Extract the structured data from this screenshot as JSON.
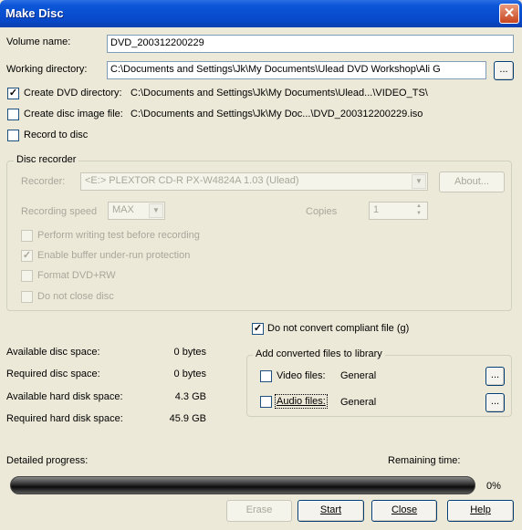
{
  "window": {
    "title": "Make Disc"
  },
  "volume": {
    "label": "Volume name:",
    "value": "DVD_200312200229"
  },
  "working_dir": {
    "label": "Working directory:",
    "value": "C:\\Documents and Settings\\Jk\\My Documents\\Ulead DVD Workshop\\Ali G",
    "browse_label": "..."
  },
  "create_dvd_dir": {
    "label": "Create DVD directory:",
    "checked": true,
    "path": "C:\\Documents and Settings\\Jk\\My Documents\\Ulead...\\VIDEO_TS\\"
  },
  "create_image": {
    "label": "Create disc image file:",
    "checked": false,
    "path": "C:\\Documents and Settings\\Jk\\My Doc...\\DVD_200312200229.iso"
  },
  "record_to_disc": {
    "label": "Record to disc",
    "checked": false
  },
  "disc_recorder": {
    "legend": "Disc recorder",
    "recorder_label": "Recorder:",
    "recorder_value": "<E:>  PLEXTOR CD-R PX-W4824A 1.03 (Ulead)",
    "about_label": "About...",
    "speed_label": "Recording speed",
    "speed_value": "MAX",
    "copies_label": "Copies",
    "copies_value": "1",
    "options": [
      {
        "label": "Perform writing test before recording",
        "checked": false
      },
      {
        "label": "Enable buffer under-run protection",
        "checked": true
      },
      {
        "label": "Format DVD+RW",
        "checked": false
      },
      {
        "label": "Do not close disc",
        "checked": false
      }
    ]
  },
  "do_not_convert": {
    "label": "Do not convert compliant file (g)",
    "checked": true
  },
  "stats": [
    {
      "label": "Available disc space:",
      "value": "0 bytes"
    },
    {
      "label": "Required disc space:",
      "value": "0 bytes"
    },
    {
      "label": "Available hard disk space:",
      "value": "4.3 GB"
    },
    {
      "label": "Required hard disk space:",
      "value": "45.9 GB"
    }
  ],
  "library": {
    "legend": "Add converted files to library",
    "video": {
      "label": "Video files:",
      "value": "General",
      "checked": false,
      "browse_label": "..."
    },
    "audio": {
      "label": "Audio files:",
      "value": "General",
      "checked": false,
      "browse_label": "..."
    }
  },
  "progress": {
    "detailed_label": "Detailed progress:",
    "remaining_label": "Remaining time:",
    "percent_text": "0%",
    "fraction": 0
  },
  "buttons": {
    "erase": "Erase",
    "start": "Start",
    "close": "Close",
    "help": "Help"
  }
}
